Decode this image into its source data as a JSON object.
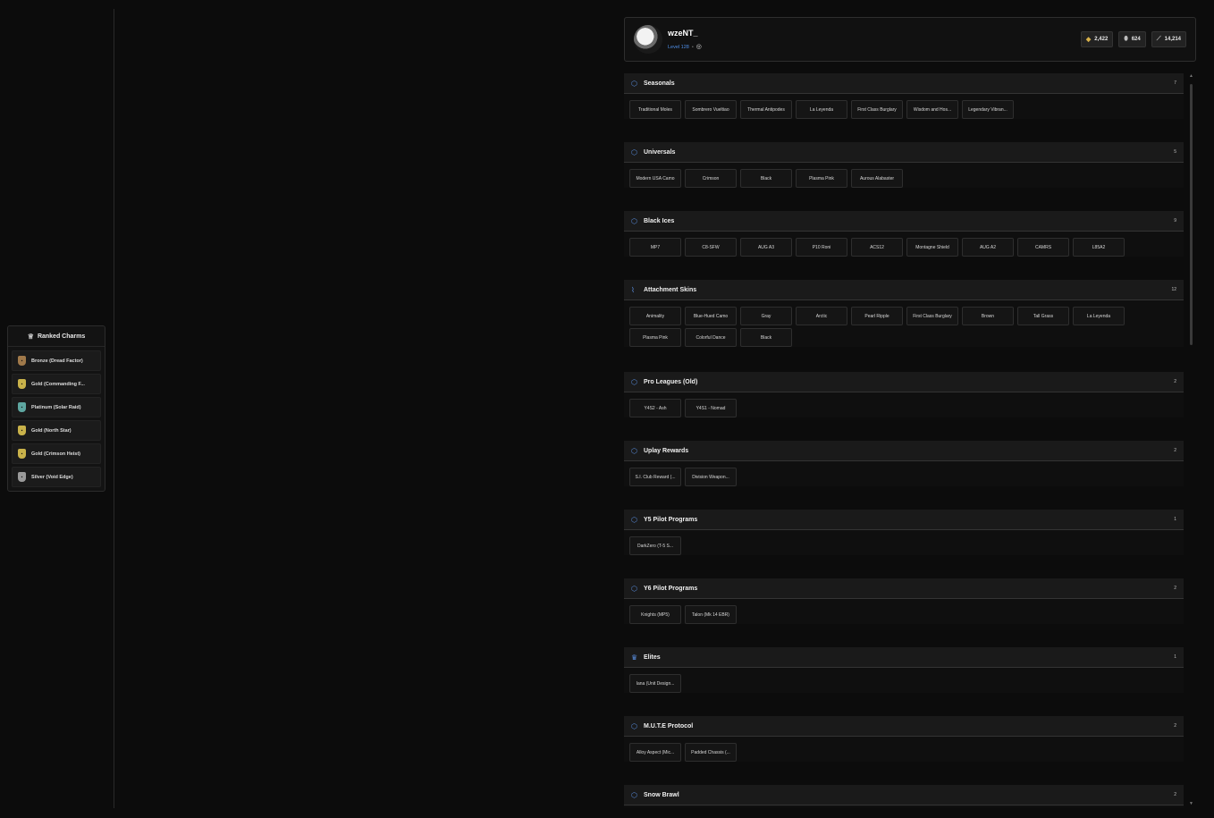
{
  "profile": {
    "username": "wzeNT_",
    "level": "Level 128",
    "stats": [
      {
        "icon": "renown-icon",
        "value": "2,422"
      },
      {
        "icon": "credits-icon",
        "value": "624"
      },
      {
        "icon": "trend-icon",
        "value": "14,214"
      }
    ]
  },
  "ranked_charms": {
    "title": "Ranked Charms",
    "items": [
      {
        "label": "Bronze (Dread Factor)",
        "tier": "bronze"
      },
      {
        "label": "Gold (Commanding F...",
        "tier": "gold"
      },
      {
        "label": "Platinum (Solar Raid)",
        "tier": "platinum"
      },
      {
        "label": "Gold (North Star)",
        "tier": "gold"
      },
      {
        "label": "Gold (Crimson Heist)",
        "tier": "gold"
      },
      {
        "label": "Silver (Void Edge)",
        "tier": "silver"
      }
    ]
  },
  "categories": [
    {
      "title": "Seasonals",
      "count": "7",
      "icon": "cube-icon",
      "items": [
        "Traditional Moles",
        "Sombrero Vueltiao",
        "Thermal Antipodes",
        "La Leyenda",
        "First Class Burglary",
        "Wisdom and Hos...",
        "Legendary Vibran..."
      ]
    },
    {
      "title": "Universals",
      "count": "5",
      "icon": "cube-icon",
      "items": [
        "Modern USA Camo",
        "Crimson",
        "Black",
        "Plasma Pink",
        "Aurous Alabaster"
      ]
    },
    {
      "title": "Black Ices",
      "count": "9",
      "icon": "cube-icon",
      "items": [
        "MP7",
        "C8-SFW",
        "AUG A3",
        "P10 Roni",
        "ACS12",
        "Montagne Shield",
        "AUG A2",
        "CAMRS",
        "L85A2"
      ]
    },
    {
      "title": "Attachment Skins",
      "count": "12",
      "icon": "paperclip-icon",
      "items": [
        "Animality",
        "Blue-Hued Camo",
        "Gray",
        "Arctic",
        "Pearl Ripple",
        "First Class Burglary",
        "Brown",
        "Tall Grass",
        "La Leyenda",
        "Plasma Pink",
        "Colorful Dance",
        "Black"
      ]
    },
    {
      "title": "Pro Leagues (Old)",
      "count": "2",
      "icon": "cube-icon",
      "items": [
        "Y4S2 - Ash",
        "Y4S1 - Nomad"
      ]
    },
    {
      "title": "Uplay Rewards",
      "count": "2",
      "icon": "cube-icon",
      "items": [
        "S.I. Club Reward (...",
        "Division Weapon..."
      ]
    },
    {
      "title": "Y5 Pilot Programs",
      "count": "1",
      "icon": "cube-icon",
      "items": [
        "DarkZero (T-5 S..."
      ]
    },
    {
      "title": "Y6 Pilot Programs",
      "count": "2",
      "icon": "cube-icon",
      "items": [
        "Knights (MP5)",
        "Talon (Mk 14 EBR)"
      ]
    },
    {
      "title": "Elites",
      "count": "1",
      "icon": "crown-icon",
      "items": [
        "Iana (Unit Design..."
      ]
    },
    {
      "title": "M.U.T.E Protocol",
      "count": "2",
      "icon": "cube-icon",
      "items": [
        "Alloy Aspect (Mic...",
        "Padded Chassis (..."
      ]
    },
    {
      "title": "Snow Brawl",
      "count": "2",
      "icon": "cube-icon",
      "items": []
    }
  ]
}
